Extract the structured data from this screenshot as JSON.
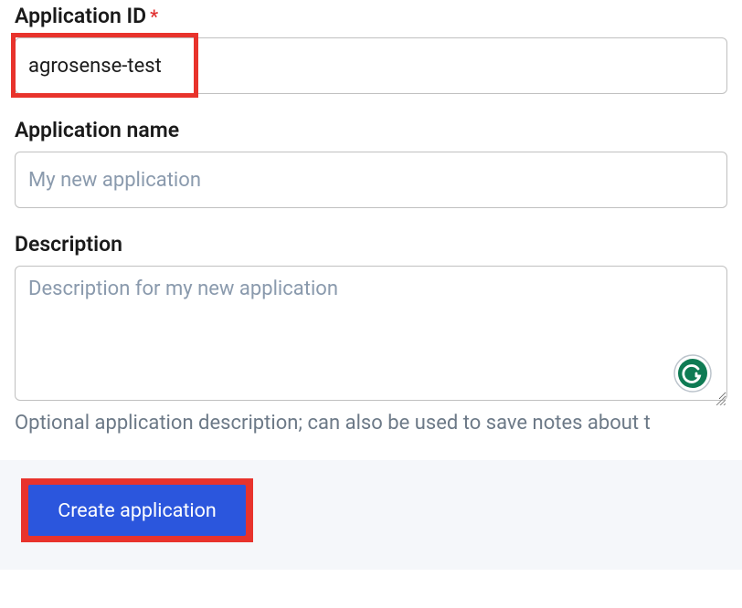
{
  "fields": {
    "app_id": {
      "label": "Application ID",
      "value": "agrosense-test",
      "required_mark": "*"
    },
    "app_name": {
      "label": "Application name",
      "placeholder": "My new application"
    },
    "description": {
      "label": "Description",
      "placeholder": "Description for my new application",
      "help": "Optional application description; can also be used to save notes about t"
    }
  },
  "actions": {
    "create_label": "Create application"
  }
}
